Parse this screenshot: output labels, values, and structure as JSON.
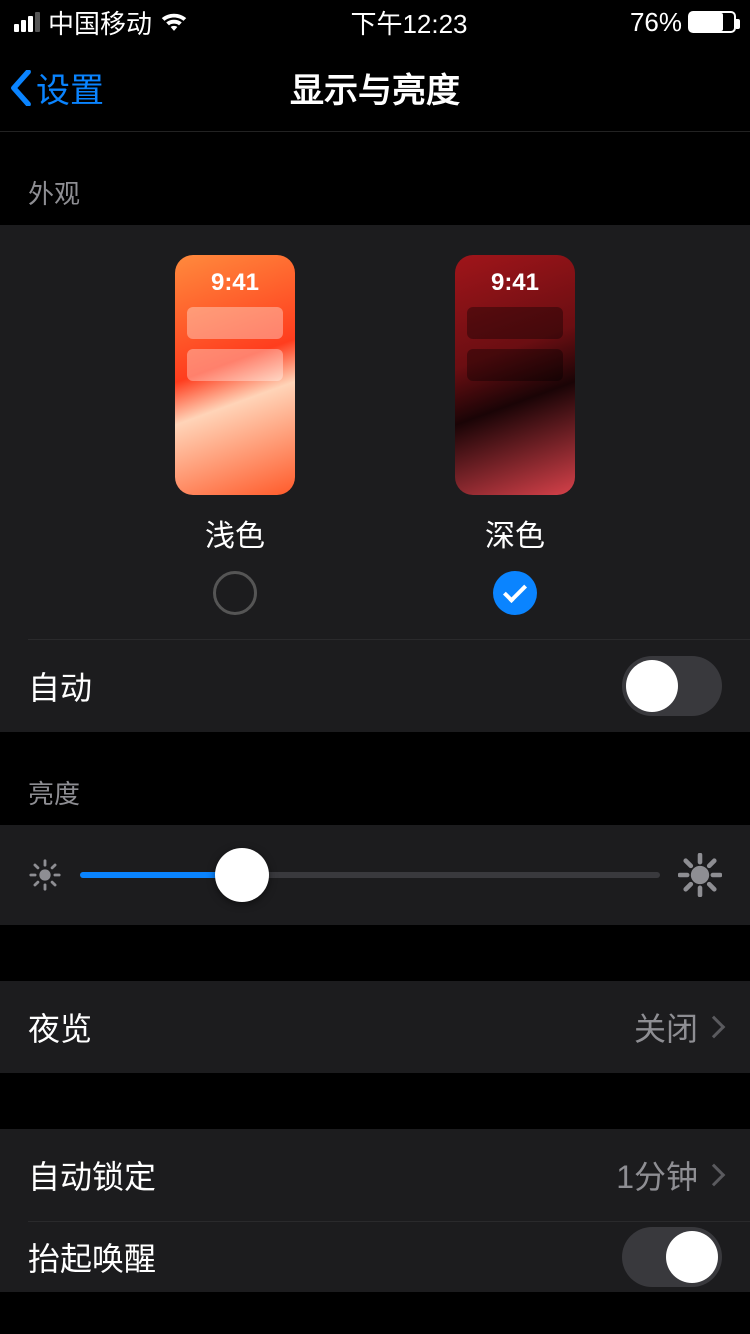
{
  "status": {
    "carrier": "中国移动",
    "time": "下午12:23",
    "battery_pct": "76%",
    "battery_fill_pct": 76
  },
  "nav": {
    "back_label": "设置",
    "title": "显示与亮度"
  },
  "appearance": {
    "header": "外观",
    "preview_time": "9:41",
    "light_label": "浅色",
    "dark_label": "深色",
    "selected": "dark",
    "auto_label": "自动",
    "auto_on": false
  },
  "brightness": {
    "header": "亮度",
    "value_pct": 28
  },
  "night_shift": {
    "label": "夜览",
    "value": "关闭"
  },
  "auto_lock": {
    "label": "自动锁定",
    "value": "1分钟"
  },
  "raise_to_wake": {
    "label": "抬起唤醒"
  }
}
